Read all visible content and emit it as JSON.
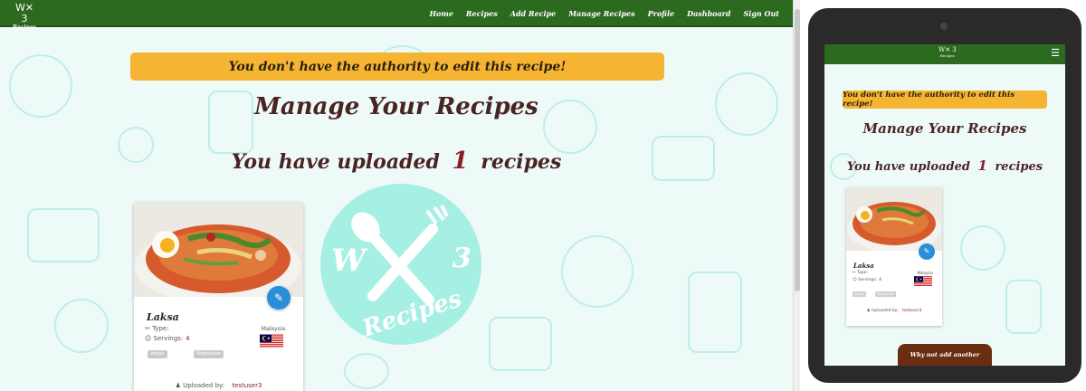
{
  "navbar": {
    "brand_mark": "W✕ 3",
    "brand_text": "Recipes",
    "links": [
      "Home",
      "Recipes",
      "Add Recipe",
      "Manage Recipes",
      "Profile",
      "Dashboard",
      "Sign Out"
    ]
  },
  "alert": {
    "message": "You don't have the authority to edit this recipe!"
  },
  "page": {
    "title": "Manage Your Recipes",
    "uploaded_prefix": "You have uploaded",
    "uploaded_count": "1",
    "uploaded_suffix": "recipes"
  },
  "recipe": {
    "name": "Laksa",
    "type_label": "Type:",
    "servings_label": "Servings:",
    "servings": "4",
    "country": "Malaysia",
    "tags": [
      "Vegan",
      "Vegetarian"
    ],
    "uploaded_by_label": "Uploaded by:",
    "uploader": "testuser3"
  },
  "logo": {
    "letter_left": "W",
    "number_right": "3",
    "text": "Recipes"
  },
  "tablet": {
    "add_button": "Why not add another recipe?",
    "menu_icon": "☰"
  },
  "colors": {
    "nav_green": "#2c6a1f",
    "alert_amber": "#f5b431",
    "title_brown": "#4a2424",
    "accent_red": "#8b1e2c",
    "logo_teal": "#a6efe3",
    "edit_blue": "#2b8ed8"
  }
}
